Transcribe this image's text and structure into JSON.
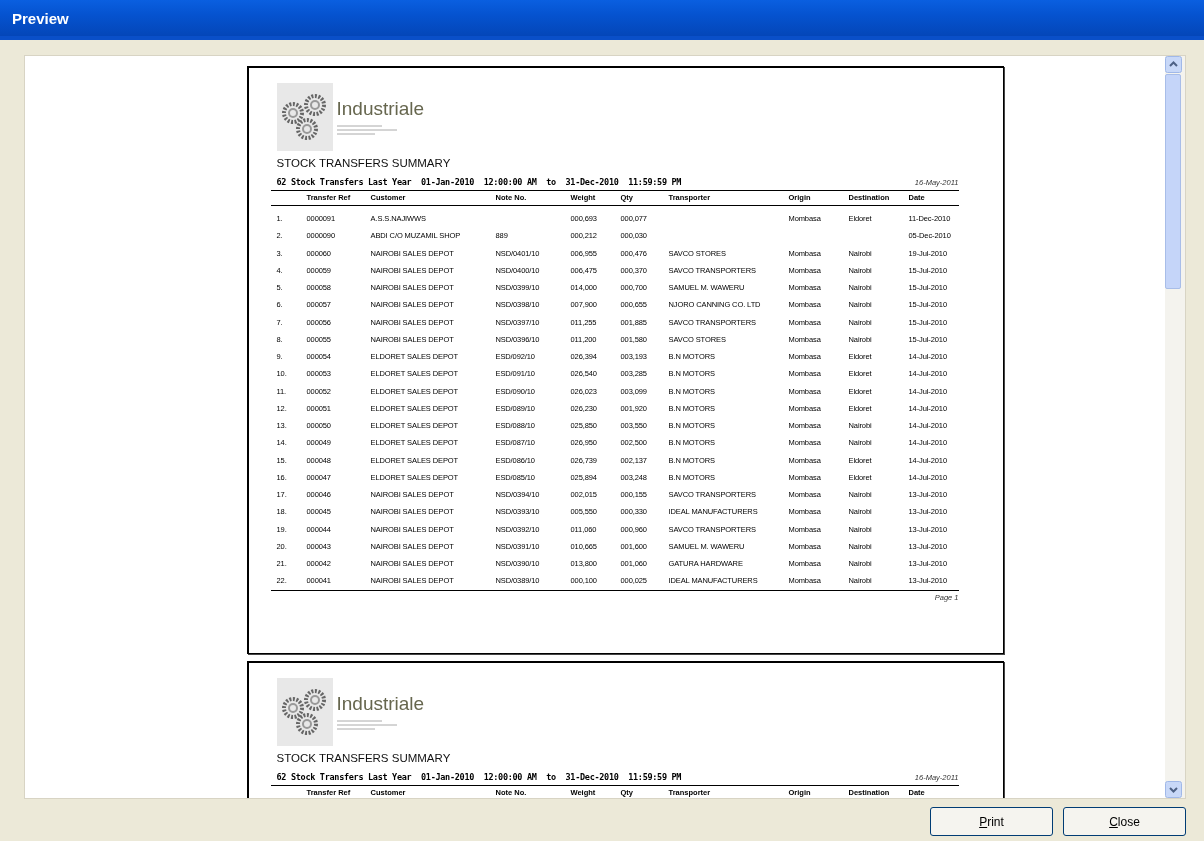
{
  "window": {
    "title": "Preview"
  },
  "pages": [
    {
      "logo": {
        "name": "Industriale"
      },
      "title": "STOCK TRANSFERS SUMMARY",
      "subtitle": "62 Stock Transfers Last Year  01-Jan-2010  12:00:00 AM  to  31-Dec-2010  11:59:59 PM",
      "printed_date": "16-May-2011",
      "columns": [
        "",
        "Transfer Ref",
        "Customer",
        "Note No.",
        "Weight",
        "Qty",
        "Transporter",
        "Origin",
        "Destination",
        "Date"
      ],
      "rows": [
        [
          "1.",
          "0000091",
          "A.S.S.NAJIWWS",
          null,
          "000,693",
          "000,077",
          null,
          "Mombasa",
          "Eldoret",
          "11-Dec-2010"
        ],
        [
          "2.",
          "0000090",
          "ABDI C/O MUZAMIL SHOP",
          "889",
          "000,212",
          "000,030",
          null,
          null,
          null,
          "05-Dec-2010"
        ],
        [
          "3.",
          "000060",
          "NAIROBI SALES DEPOT",
          "NSD/0401/10",
          "006,955",
          "000,476",
          "SAVCO STORES",
          "Mombasa",
          "Nairobi",
          "19-Jul-2010"
        ],
        [
          "4.",
          "000059",
          "NAIROBI SALES DEPOT",
          "NSD/0400/10",
          "006,475",
          "000,370",
          "SAVCO TRANSPORTERS",
          "Mombasa",
          "Nairobi",
          "15-Jul-2010"
        ],
        [
          "5.",
          "000058",
          "NAIROBI SALES DEPOT",
          "NSD/0399/10",
          "014,000",
          "000,700",
          "SAMUEL M. WAWERU",
          "Mombasa",
          "Nairobi",
          "15-Jul-2010"
        ],
        [
          "6.",
          "000057",
          "NAIROBI SALES DEPOT",
          "NSD/0398/10",
          "007,900",
          "000,655",
          "NJORO CANNING CO. LTD",
          "Mombasa",
          "Nairobi",
          "15-Jul-2010"
        ],
        [
          "7.",
          "000056",
          "NAIROBI SALES DEPOT",
          "NSD/0397/10",
          "011,255",
          "001,885",
          "SAVCO TRANSPORTERS",
          "Mombasa",
          "Nairobi",
          "15-Jul-2010"
        ],
        [
          "8.",
          "000055",
          "NAIROBI SALES DEPOT",
          "NSD/0396/10",
          "011,200",
          "001,580",
          "SAVCO STORES",
          "Mombasa",
          "Nairobi",
          "15-Jul-2010"
        ],
        [
          "9.",
          "000054",
          "ELDORET SALES DEPOT",
          "ESD/092/10",
          "026,394",
          "003,193",
          "B.N MOTORS",
          "Mombasa",
          "Eldoret",
          "14-Jul-2010"
        ],
        [
          "10.",
          "000053",
          "ELDORET SALES DEPOT",
          "ESD/091/10",
          "026,540",
          "003,285",
          "B.N MOTORS",
          "Mombasa",
          "Eldoret",
          "14-Jul-2010"
        ],
        [
          "11.",
          "000052",
          "ELDORET SALES DEPOT",
          "ESD/090/10",
          "026,023",
          "003,099",
          "B.N MOTORS",
          "Mombasa",
          "Eldoret",
          "14-Jul-2010"
        ],
        [
          "12.",
          "000051",
          "ELDORET SALES DEPOT",
          "ESD/089/10",
          "026,230",
          "001,920",
          "B.N MOTORS",
          "Mombasa",
          "Eldoret",
          "14-Jul-2010"
        ],
        [
          "13.",
          "000050",
          "ELDORET SALES DEPOT",
          "ESD/088/10",
          "025,850",
          "003,550",
          "B.N MOTORS",
          "Mombasa",
          "Nairobi",
          "14-Jul-2010"
        ],
        [
          "14.",
          "000049",
          "ELDORET SALES DEPOT",
          "ESD/087/10",
          "026,950",
          "002,500",
          "B.N MOTORS",
          "Mombasa",
          "Nairobi",
          "14-Jul-2010"
        ],
        [
          "15.",
          "000048",
          "ELDORET SALES DEPOT",
          "ESD/086/10",
          "026,739",
          "002,137",
          "B.N MOTORS",
          "Mombasa",
          "Eldoret",
          "14-Jul-2010"
        ],
        [
          "16.",
          "000047",
          "ELDORET SALES DEPOT",
          "ESD/085/10",
          "025,894",
          "003,248",
          "B.N MOTORS",
          "Mombasa",
          "Eldoret",
          "14-Jul-2010"
        ],
        [
          "17.",
          "000046",
          "NAIROBI SALES DEPOT",
          "NSD/0394/10",
          "002,015",
          "000,155",
          "SAVCO TRANSPORTERS",
          "Mombasa",
          "Nairobi",
          "13-Jul-2010"
        ],
        [
          "18.",
          "000045",
          "NAIROBI SALES DEPOT",
          "NSD/0393/10",
          "005,550",
          "000,330",
          "IDEAL MANUFACTURERS",
          "Mombasa",
          "Nairobi",
          "13-Jul-2010"
        ],
        [
          "19.",
          "000044",
          "NAIROBI SALES DEPOT",
          "NSD/0392/10",
          "011,060",
          "000,960",
          "SAVCO TRANSPORTERS",
          "Mombasa",
          "Nairobi",
          "13-Jul-2010"
        ],
        [
          "20.",
          "000043",
          "NAIROBI SALES DEPOT",
          "NSD/0391/10",
          "010,665",
          "001,600",
          "SAMUEL M. WAWERU",
          "Mombasa",
          "Nairobi",
          "13-Jul-2010"
        ],
        [
          "21.",
          "000042",
          "NAIROBI SALES DEPOT",
          "NSD/0390/10",
          "013,800",
          "001,060",
          "GATURA HARDWARE",
          "Mombasa",
          "Nairobi",
          "13-Jul-2010"
        ],
        [
          "22.",
          "000041",
          "NAIROBI SALES DEPOT",
          "NSD/0389/10",
          "000,100",
          "000,025",
          "IDEAL MANUFACTURERS",
          "Mombasa",
          "Nairobi",
          "13-Jul-2010"
        ]
      ],
      "footer": "Page 1"
    },
    {
      "logo": {
        "name": "Industriale"
      },
      "title": "STOCK TRANSFERS SUMMARY",
      "subtitle": "62 Stock Transfers Last Year  01-Jan-2010  12:00:00 AM  to  31-Dec-2010  11:59:59 PM",
      "printed_date": "16-May-2011",
      "columns": [
        "",
        "Transfer Ref",
        "Customer",
        "Note No.",
        "Weight",
        "Qty",
        "Transporter",
        "Origin",
        "Destination",
        "Date"
      ]
    }
  ],
  "buttons": [
    {
      "label": "Print"
    },
    {
      "label": "Close"
    }
  ]
}
